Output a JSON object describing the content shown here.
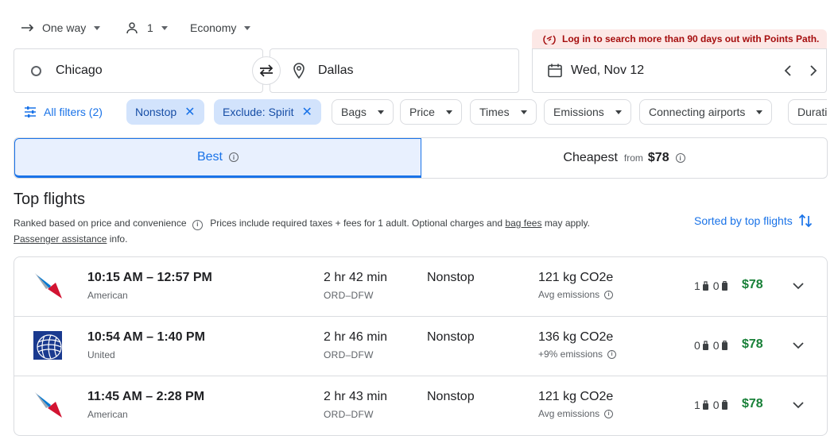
{
  "search": {
    "trip_type": "One way",
    "passengers": "1",
    "cabin": "Economy",
    "origin": "Chicago",
    "destination": "Dallas",
    "date": "Wed, Nov 12"
  },
  "banner": {
    "text": "Log in to search more than 90 days out with Points Path."
  },
  "filters": {
    "all_filters": "All filters (2)",
    "active": [
      "Nonstop",
      "Exclude: Spirit"
    ],
    "dropdowns": [
      "Bags",
      "Price",
      "Times",
      "Emissions",
      "Connecting airports",
      "Duration"
    ]
  },
  "tabs": {
    "best": "Best",
    "cheapest": "Cheapest",
    "cheapest_from": "from",
    "cheapest_price": "$78"
  },
  "results": {
    "title": "Top flights",
    "ranked_note": "Ranked based on price and convenience",
    "prices_note": "Prices include required taxes + fees for 1 adult. Optional charges and",
    "bag_fees": "bag fees",
    "may_apply": "may apply.",
    "passenger_assistance": "Passenger assistance",
    "info": "info.",
    "sorted_by": "Sorted by top flights"
  },
  "flights": [
    {
      "times": "10:15 AM – 12:57 PM",
      "airline": "American",
      "duration": "2 hr 42 min",
      "route": "ORD–DFW",
      "stops": "Nonstop",
      "co2": "121 kg CO2e",
      "emissions": "Avg emissions",
      "carry_on": "1",
      "checked": "0",
      "price": "$78",
      "logo": "american"
    },
    {
      "times": "10:54 AM – 1:40 PM",
      "airline": "United",
      "duration": "2 hr 46 min",
      "route": "ORD–DFW",
      "stops": "Nonstop",
      "co2": "136 kg CO2e",
      "emissions": "+9% emissions",
      "carry_on": "0",
      "checked": "0",
      "price": "$78",
      "logo": "united"
    },
    {
      "times": "11:45 AM – 2:28 PM",
      "airline": "American",
      "duration": "2 hr 43 min",
      "route": "ORD–DFW",
      "stops": "Nonstop",
      "co2": "121 kg CO2e",
      "emissions": "Avg emissions",
      "carry_on": "1",
      "checked": "0",
      "price": "$78",
      "logo": "american"
    }
  ],
  "colors": {
    "accent": "#1a73e8",
    "price_green": "#188038",
    "banner_red": "#a50e0e",
    "chip_fill": "#d2e3fc"
  }
}
